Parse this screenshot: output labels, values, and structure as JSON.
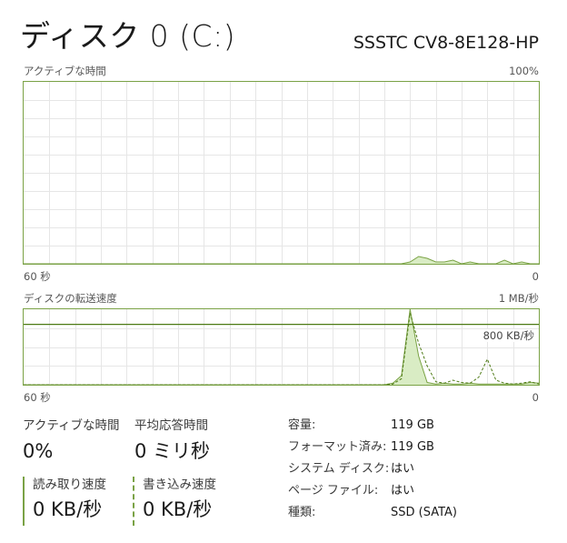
{
  "header": {
    "title": "ディスク 0 (C:)",
    "model": "SSSTC CV8-8E128-HP"
  },
  "activity_graph": {
    "label": "アクティブな時間",
    "max_label": "100%",
    "left_axis_label": "60 秒",
    "right_axis_label": "0",
    "line_color": "#7aa245",
    "fill_color": "#d9ecc4",
    "ylim": [
      0,
      100
    ],
    "series_percent": [
      0,
      0,
      0,
      0,
      0,
      0,
      0,
      0,
      0,
      0,
      0,
      0,
      0,
      0,
      0,
      0,
      0,
      0,
      0,
      0,
      0,
      0,
      0,
      0,
      0,
      0,
      0,
      0,
      0,
      0,
      0,
      0,
      0,
      0,
      0,
      0,
      0,
      0,
      0,
      0,
      0,
      0,
      0,
      0,
      0,
      1,
      4,
      3,
      1,
      1,
      2,
      0,
      1,
      0,
      0,
      0,
      2,
      0,
      1,
      0,
      0
    ]
  },
  "transfer_graph": {
    "label": "ディスクの転送速度",
    "max_label": "1 MB/秒",
    "ref_line_label": "800 KB/秒",
    "left_axis_label": "60 秒",
    "right_axis_label": "0",
    "line_color": "#4d7a14",
    "fill_color": "#d9ecc4",
    "ref_line_ratio": 0.8,
    "read_series": [
      0,
      0,
      0,
      0,
      0,
      0,
      0,
      0,
      0,
      0,
      0,
      0,
      0,
      0,
      0,
      0,
      0,
      0,
      0,
      0,
      0,
      0,
      0,
      0,
      0,
      0,
      0,
      0,
      0,
      0,
      0,
      0,
      0,
      0,
      0,
      0,
      0,
      0,
      0,
      0,
      0,
      0,
      0,
      2,
      12,
      100,
      38,
      3,
      1,
      2,
      1,
      1,
      2,
      1,
      1,
      1,
      1,
      1,
      1,
      3,
      2
    ],
    "write_series": [
      0,
      0,
      0,
      0,
      0,
      0,
      0,
      0,
      0,
      0,
      0,
      0,
      0,
      0,
      0,
      0,
      0,
      0,
      0,
      0,
      0,
      0,
      0,
      0,
      0,
      0,
      0,
      0,
      0,
      0,
      0,
      0,
      0,
      0,
      0,
      0,
      0,
      0,
      0,
      0,
      0,
      0,
      0,
      1,
      8,
      95,
      55,
      25,
      4,
      2,
      6,
      3,
      2,
      10,
      34,
      6,
      2,
      1,
      2,
      4,
      1
    ]
  },
  "stats": {
    "active_time": {
      "label": "アクティブな時間",
      "value": "0%"
    },
    "avg_response": {
      "label": "平均応答時間",
      "value": "0 ミリ秒"
    },
    "read_speed": {
      "label": "読み取り速度",
      "value": "0 KB/秒"
    },
    "write_speed": {
      "label": "書き込み速度",
      "value": "0 KB/秒"
    }
  },
  "properties": [
    {
      "key": "容量:",
      "value": "119 GB"
    },
    {
      "key": "フォーマット済み:",
      "value": "119 GB"
    },
    {
      "key": "システム ディスク:",
      "value": "はい"
    },
    {
      "key": "ページ ファイル:",
      "value": "はい"
    },
    {
      "key": "種類:",
      "value": "SSD (SATA)"
    }
  ]
}
